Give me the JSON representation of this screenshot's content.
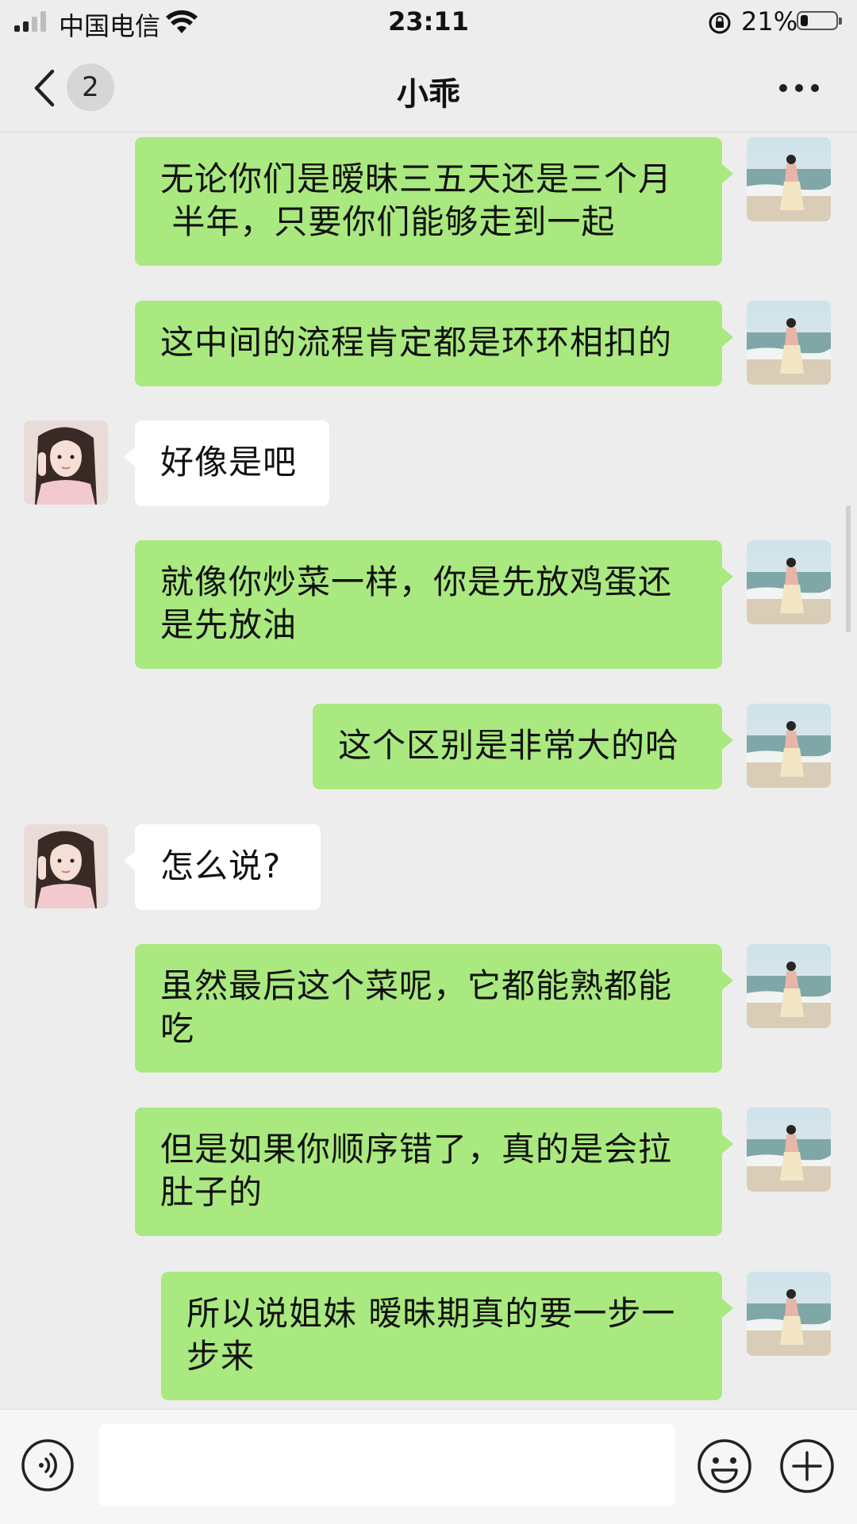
{
  "status_bar": {
    "carrier": "中国电信",
    "time": "23:11",
    "battery_percent": "21%",
    "battery_level": 0.21,
    "signal_bars": 2
  },
  "nav": {
    "unread_count": "2",
    "title": "小乖"
  },
  "messages": [
    {
      "sender": "me",
      "text": "无论你们是暧昧三五天还是三个月\n 半年，只要你们能够走到一起"
    },
    {
      "sender": "me",
      "text": "这中间的流程肯定都是环环相扣的"
    },
    {
      "sender": "them",
      "text": "好像是吧"
    },
    {
      "sender": "me",
      "text": "就像你炒菜一样，你是先放鸡蛋还\n是先放油"
    },
    {
      "sender": "me",
      "text": "这个区别是非常大的哈"
    },
    {
      "sender": "them",
      "text": "怎么说?"
    },
    {
      "sender": "me",
      "text": "虽然最后这个菜呢，它都能熟都能\n吃"
    },
    {
      "sender": "me",
      "text": "但是如果你顺序错了，真的是会拉\n肚子的"
    },
    {
      "sender": "me",
      "text": "所以说姐妹 暧昧期真的要一步一\n步来"
    }
  ],
  "input": {
    "value": "",
    "placeholder": ""
  },
  "icons": {
    "voice": "voice-icon",
    "emoji": "emoji-icon",
    "plus": "plus-icon",
    "back": "back-icon",
    "more": "more-icon"
  },
  "colors": {
    "my_bubble": "#a9e97f",
    "their_bubble": "#ffffff",
    "background": "#ededed"
  }
}
